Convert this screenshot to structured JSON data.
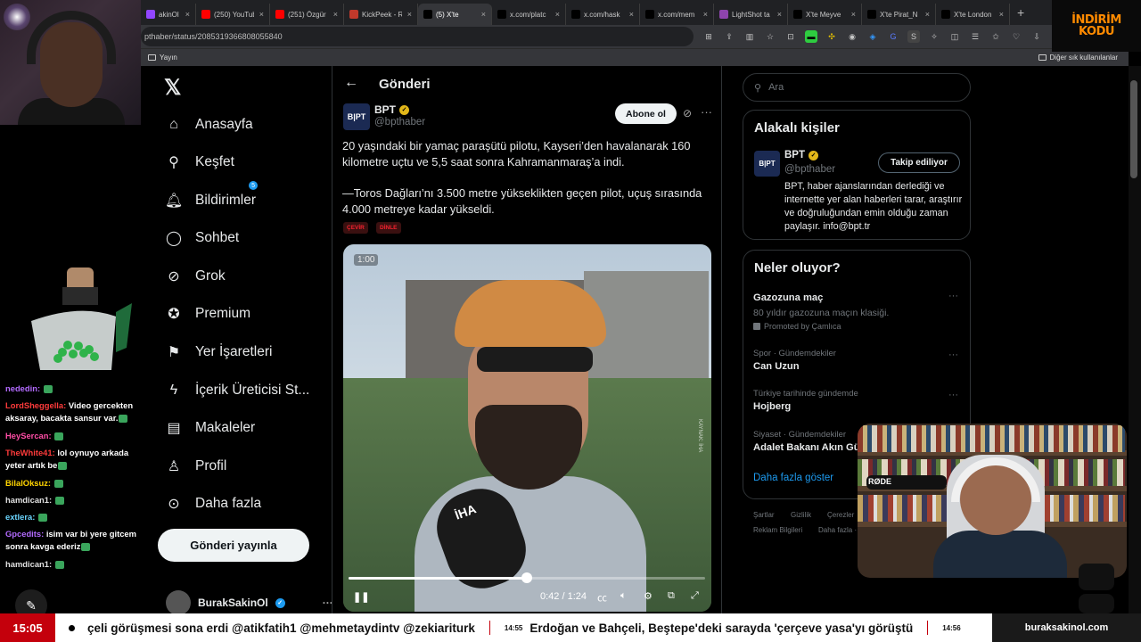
{
  "browser": {
    "tabs": [
      {
        "label": "akinOl Hab",
        "color": "#9146ff",
        "icon": "twitch-icon"
      },
      {
        "label": "(250) YouTub",
        "color": "#ff0000",
        "icon": "youtube-icon"
      },
      {
        "label": "(251) Özgür",
        "color": "#ff0000",
        "icon": "youtube-icon"
      },
      {
        "label": "KickPeek - R",
        "color": "#c0392b",
        "icon": "kickpeek-icon"
      },
      {
        "label": "(5) X'te",
        "color": "#000000",
        "icon": "x-icon",
        "active": true
      },
      {
        "label": "x.com/platc",
        "color": "#000000",
        "icon": "x-icon"
      },
      {
        "label": "x.com/hask",
        "color": "#000000",
        "icon": "x-icon"
      },
      {
        "label": "x.com/mem",
        "color": "#000000",
        "icon": "x-icon"
      },
      {
        "label": "LightShot ta",
        "color": "#8e44ad",
        "icon": "lightshot-icon"
      },
      {
        "label": "X'te Meyve",
        "color": "#000000",
        "icon": "x-icon"
      },
      {
        "label": "X'te Pirat_N",
        "color": "#000000",
        "icon": "x-icon"
      },
      {
        "label": "X'te London",
        "color": "#000000",
        "icon": "x-icon"
      }
    ],
    "new_tab": "+",
    "url": "pthaber/status/2085319366808055840",
    "bookmarks_left": "Yayın",
    "bookmarks_right": "Diğer sık kullanılanlar"
  },
  "nav": {
    "logo": "𝕏",
    "items": [
      {
        "label": "Anasayfa",
        "icon": "home-icon",
        "glyph": "⌂"
      },
      {
        "label": "Keşfet",
        "icon": "search-icon",
        "glyph": "⚲"
      },
      {
        "label": "Bildirimler",
        "icon": "bell-icon",
        "glyph": "🔔︎",
        "badge": "5"
      },
      {
        "label": "Sohbet",
        "icon": "chat-icon",
        "glyph": "◯"
      },
      {
        "label": "Grok",
        "icon": "grok-icon",
        "glyph": "⊘"
      },
      {
        "label": "Premium",
        "icon": "premium-icon",
        "glyph": "✪"
      },
      {
        "label": "Yer İşaretleri",
        "icon": "bookmark-icon",
        "glyph": "⚑"
      },
      {
        "label": "İçerik Üreticisi St...",
        "icon": "lightning-icon",
        "glyph": "ϟ"
      },
      {
        "label": "Makaleler",
        "icon": "article-icon",
        "glyph": "▤"
      },
      {
        "label": "Profil",
        "icon": "profile-icon",
        "glyph": "♙"
      },
      {
        "label": "Daha fazla",
        "icon": "more-circle-icon",
        "glyph": "⊙"
      }
    ],
    "post_button": "Gönderi yayınla",
    "user_name": "BurakSakinOl",
    "user_more": "···"
  },
  "post": {
    "back": "←",
    "heading": "Gönderi",
    "avatar_text": "B|PT",
    "author_name": "BPT",
    "author_handle": "@bpthaber",
    "follow_label": "Abone ol",
    "paragraph1": "20 yaşındaki bir yamaç paraşütü pilotu, Kayseri’den havalanarak 160 kilometre uçtu ve 5,5 saat sonra Kahramanmaraş’a indi.",
    "paragraph2": "—Toros Dağları’nı 3.500 metre yükseklikten geçen pilot, uçuş sırasında 4.000 metreye kadar yükseldi.",
    "tag1": "ÇEVİR",
    "tag2": "DİNLE",
    "video": {
      "overlay_time": "1:00",
      "mic_label": "İHA",
      "watermark": "KAYNAK: İHA",
      "current": "0:42",
      "duration": "1:24",
      "time_display": "0:42 / 1:24",
      "progress": 0.5
    }
  },
  "right": {
    "search_placeholder": "Ara",
    "related_title": "Alakalı kişiler",
    "related_avatar": "B|PT",
    "related_name": "BPT",
    "related_handle": "@bpthaber",
    "following_label": "Takip ediliyor",
    "related_bio": "BPT, haber ajanslarından derlediği ve internette yer alan haberleri tarar, araştırır ve doğruluğundan emin olduğu zaman paylaşır. info@bpt.tr",
    "trends_title": "Neler oluyor?",
    "trends": [
      {
        "name": "Gazozuna maç",
        "sub": "80 yıldır gazozuna maçın klasiği.",
        "promoted": "Promoted by Çamlıca"
      },
      {
        "meta": "Spor · Gündemdekiler",
        "name": "Can Uzun"
      },
      {
        "meta": "Türkiye tarihinde gündemde",
        "name": "Hojberg"
      },
      {
        "meta": "Siyaset · Gündemdekiler",
        "name": "Adalet Bakanı Akın Gü"
      }
    ],
    "show_more": "Daha fazla göster",
    "footer": [
      "Şartlar",
      "Gizlilik",
      "Çerezler",
      "Reklam Bilgileri",
      "Daha fazla ·"
    ]
  },
  "chat": [
    {
      "user": "nededin:",
      "user_color": "#b36bff",
      "msg": ""
    },
    {
      "user": "LordSheggella:",
      "user_color": "#ff3b3b",
      "msg": "Video gercekten aksaray, bacakta sansur var."
    },
    {
      "user": "HeySercan:",
      "user_color": "#ff4da6",
      "msg": ""
    },
    {
      "user": "TheWhite41:",
      "user_color": "#ff3b3b",
      "msg": "lol oynuyo arkada yeter artık be"
    },
    {
      "user": "BilalOksuz:",
      "user_color": "#ffd400",
      "msg": ""
    },
    {
      "user": "hamdican1:",
      "user_color": "#e0e0e0",
      "msg": ""
    },
    {
      "user": "extlera:",
      "user_color": "#6bd6ff",
      "msg": ""
    },
    {
      "user": "Gpcedits:",
      "user_color": "#b36bff",
      "msg": "isim var bi yere gitcem sonra kavga ederiz"
    },
    {
      "user": "hamdican1:",
      "user_color": "#e0e0e0",
      "msg": ""
    }
  ],
  "promo": {
    "line1": "İNDİRİM",
    "line2": "KODU"
  },
  "ticker": {
    "clock": "15:05",
    "text1": "çeli görüşmesi sona erdi @atikfatih1 @mehmetaydintv @zekiariturk",
    "time1": "14:55",
    "text2": "Erdoğan ve Bahçeli, Beştepe'deki sarayda 'çerçeve yasa'yı görüştü",
    "time2": "14:56",
    "brand": "buraksakinol.com"
  },
  "cam": {
    "mic_brand": "RØDE"
  }
}
